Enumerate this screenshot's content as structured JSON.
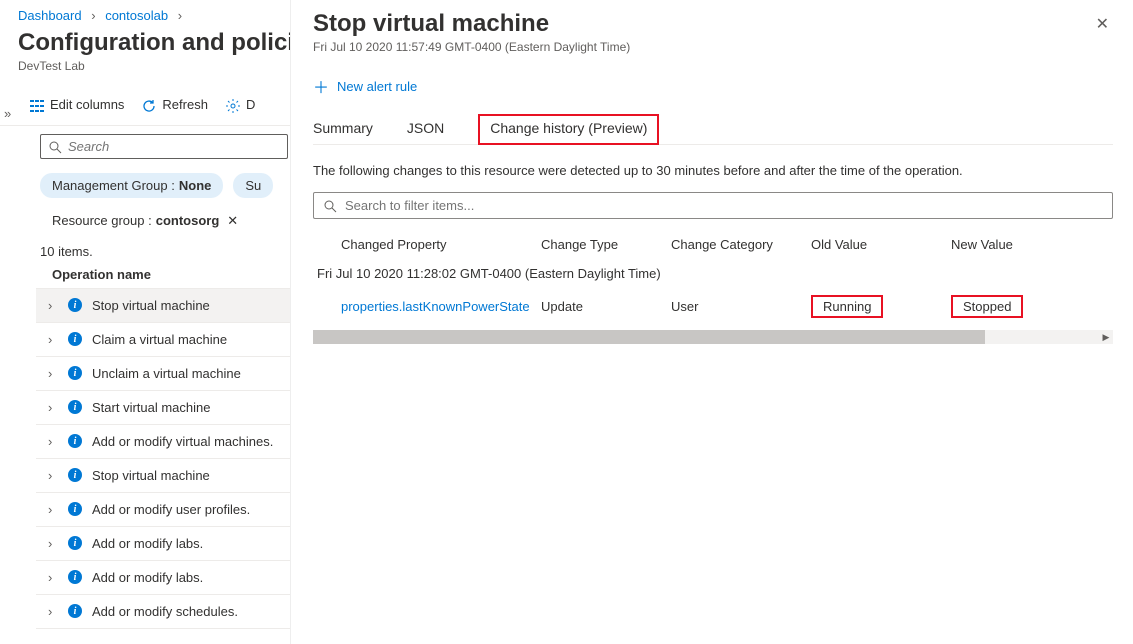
{
  "breadcrumb": {
    "root": "Dashboard",
    "item": "contosolab"
  },
  "pageTitle": "Configuration and policies",
  "pageSubtitle": "DevTest Lab",
  "toolbar": {
    "editColumns": "Edit columns",
    "refresh": "Refresh",
    "other": "D"
  },
  "search": {
    "placeholder": "Search"
  },
  "pills": {
    "mgmtGroupLabel": "Management Group : ",
    "mgmtGroupVal": "None",
    "suLabel": "Su",
    "rgLabel": "Resource group : ",
    "rgVal": "contosorg"
  },
  "itemCount": "10 items.",
  "opHeader": "Operation name",
  "ops": [
    "Stop virtual machine",
    "Claim a virtual machine",
    "Unclaim a virtual machine",
    "Start virtual machine",
    "Add or modify virtual machines.",
    "Stop virtual machine",
    "Add or modify user profiles.",
    "Add or modify labs.",
    "Add or modify labs.",
    "Add or modify schedules."
  ],
  "panel": {
    "title": "Stop virtual machine",
    "time": "Fri Jul 10 2020 11:57:49 GMT-0400 (Eastern Daylight Time)",
    "newAlert": "New alert rule",
    "tabs": {
      "summary": "Summary",
      "json": "JSON",
      "change": "Change history (Preview)"
    },
    "desc": "The following changes to this resource were detected up to 30 minutes before and after the time of the operation.",
    "filterPlaceholder": "Search to filter items...",
    "cols": {
      "prop": "Changed Property",
      "type": "Change Type",
      "cat": "Change Category",
      "old": "Old Value",
      "new": "New Value"
    },
    "groupTime": "Fri Jul 10 2020 11:28:02 GMT-0400 (Eastern Daylight Time)",
    "row": {
      "prop": "properties.lastKnownPowerState",
      "type": "Update",
      "cat": "User",
      "old": "Running",
      "new": "Stopped"
    }
  }
}
